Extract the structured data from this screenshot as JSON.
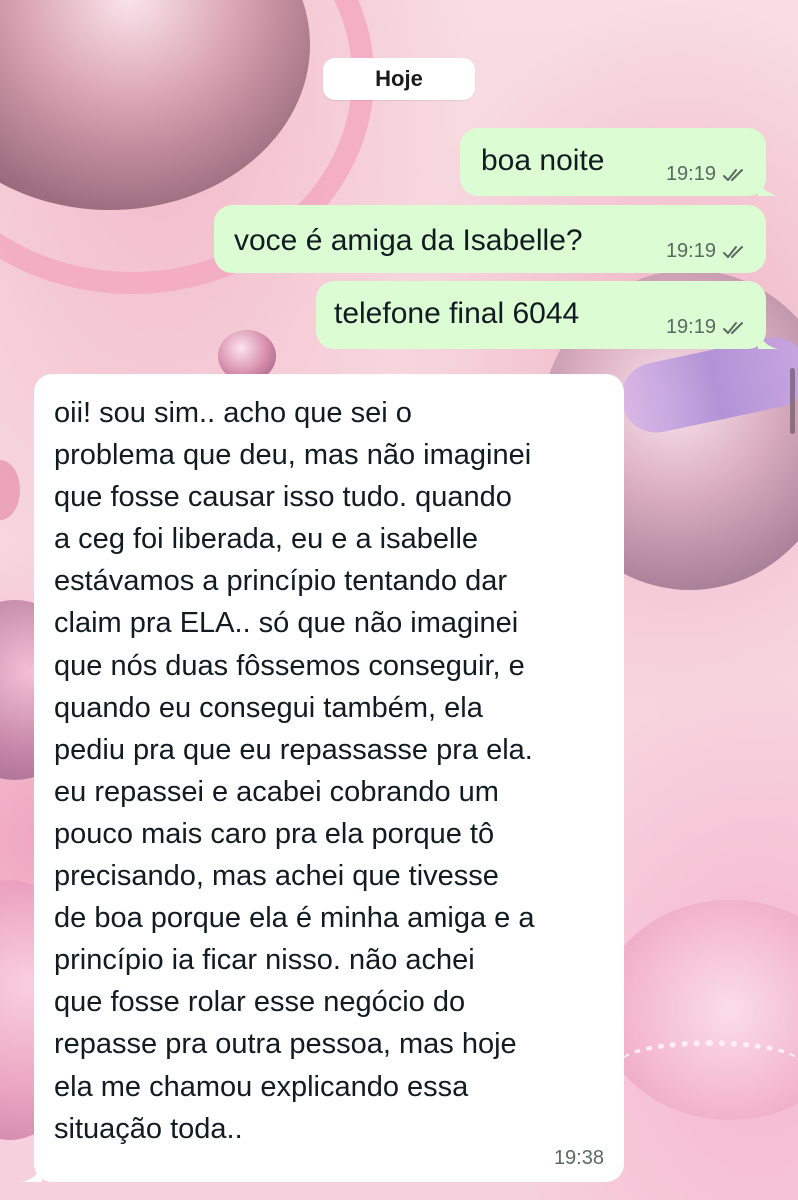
{
  "chat": {
    "date_separator": "Hoje",
    "messages": [
      {
        "direction": "outgoing",
        "text": "boa noite",
        "time": "19:19",
        "status": "read-double-check-icon"
      },
      {
        "direction": "outgoing",
        "text": "voce é amiga da Isabelle?",
        "time": "19:19",
        "status": "read-double-check-icon"
      },
      {
        "direction": "outgoing",
        "text": "telefone final 6044",
        "time": "19:19",
        "status": "read-double-check-icon"
      },
      {
        "direction": "incoming",
        "time": "19:38",
        "lines": [
          "oii! sou sim.. acho que sei o",
          "problema que deu, mas não imaginei",
          "que fosse causar isso tudo. quando",
          "a ceg foi liberada, eu e a isabelle",
          "estávamos a princípio tentando dar",
          "claim pra ELA.. só que não imaginei",
          "que nós duas fôssemos conseguir, e",
          "quando eu consegui também, ela",
          "pediu pra que eu repassasse pra ela.",
          "eu repassei e acabei cobrando um",
          "pouco mais caro pra ela porque tô",
          "precisando, mas achei que tivesse",
          "de boa porque ela é minha amiga e a",
          "princípio ia ficar nisso. não achei",
          "que fosse rolar esse negócio do",
          "repasse pra outra pessoa, mas hoje",
          "ela me chamou explicando essa",
          "situação toda.."
        ]
      }
    ]
  },
  "colors": {
    "outgoing_bubble": "#dcfcd3",
    "incoming_bubble": "#ffffff",
    "wallpaper": "#f6d3dc"
  }
}
